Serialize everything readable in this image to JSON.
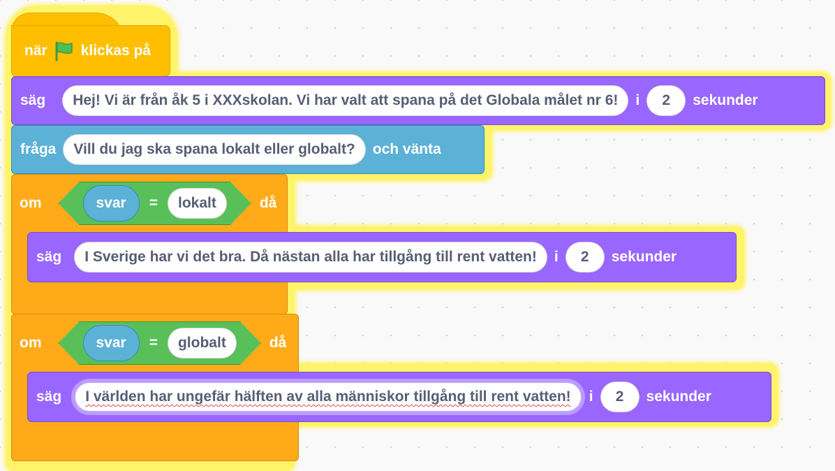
{
  "script": {
    "hat": {
      "prefix": "när",
      "icon": "green-flag-icon",
      "suffix": "klickas på"
    },
    "say1": {
      "verb": "säg",
      "message": "Hej! Vi är från åk 5 i XXXskolan. Vi har valt att spana på det Globala målet nr 6!",
      "in": "i",
      "seconds": "2",
      "unit": "sekunder"
    },
    "ask": {
      "verb": "fråga",
      "question": "Vill du jag ska spana lokalt eller globalt?",
      "suffix": "och vänta"
    },
    "if1": {
      "keyword": "om",
      "variable": "svar",
      "operator": "=",
      "value": "lokalt",
      "then": "då",
      "say": {
        "verb": "säg",
        "message": "I Sverige har vi det bra. Då nästan alla har tillgång till rent vatten!",
        "in": "i",
        "seconds": "2",
        "unit": "sekunder"
      }
    },
    "if2": {
      "keyword": "om",
      "variable": "svar",
      "operator": "=",
      "value": "globalt",
      "then": "då",
      "say": {
        "verb": "säg",
        "message": "I världen har ungefär hälften av alla människor tillgång till rent vatten!",
        "in": "i",
        "seconds": "2",
        "unit": "sekunder"
      }
    }
  },
  "colors": {
    "events": "#ffbf00",
    "looks": "#9966ff",
    "sensing": "#5cb1d6",
    "control": "#ffab19",
    "operators": "#59c059",
    "glow": "#fff36a",
    "flag": "#4cbf56"
  }
}
